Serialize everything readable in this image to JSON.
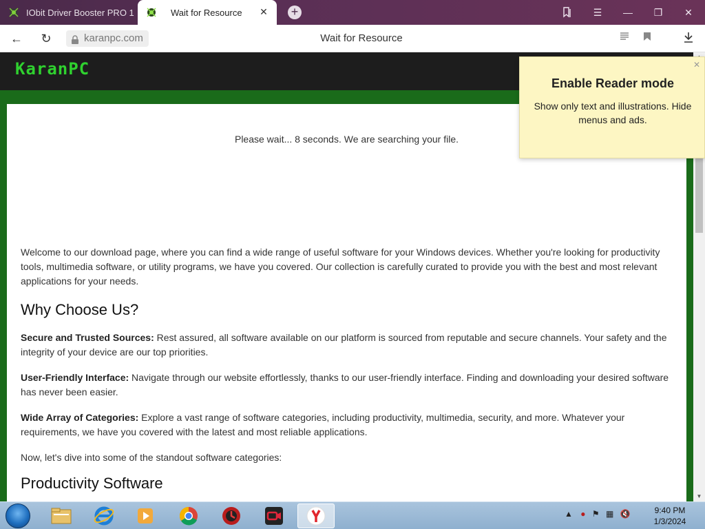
{
  "browser": {
    "tabs": [
      {
        "label": "IObit Driver Booster PRO 1",
        "active": false
      },
      {
        "label": "Wait for Resource",
        "active": true
      }
    ],
    "url": "karanpc.com",
    "page_title": "Wait for Resource",
    "colors": {
      "tabbar": "#5a2f55",
      "logo": "#2fd12f",
      "band": "#1a6b1a"
    }
  },
  "site": {
    "logo": "KaranPC",
    "wait_message": "Please wait... 8 seconds. We are searching your file."
  },
  "article": {
    "intro": "Welcome to our download page, where you can find a wide range of useful software for your Windows devices. Whether you're looking for productivity tools, multimedia software, or utility programs, we have you covered. Our collection is carefully curated to provide you with the best and most relevant applications for your needs.",
    "why_heading": "Why Choose Us?",
    "points": [
      {
        "title": "Secure and Trusted Sources:",
        "text": " Rest assured, all software available on our platform is sourced from reputable and secure channels. Your safety and the integrity of your device are our top priorities."
      },
      {
        "title": "User-Friendly Interface:",
        "text": " Navigate through our website effortlessly, thanks to our user-friendly interface. Finding and downloading your desired software has never been easier."
      },
      {
        "title": "Wide Array of Categories:",
        "text": " Explore a vast range of software categories, including productivity, multimedia, security, and more. Whatever your requirements, we have you covered with the latest and most reliable applications."
      }
    ],
    "dive_text": "Now, let's dive into some of the standout software categories:",
    "next_heading": "Productivity Software"
  },
  "reader_popup": {
    "title": "Enable Reader mode",
    "description": "Show only text and illustrations. Hide menus and ads."
  },
  "taskbar": {
    "time": "9:40 PM",
    "date": "1/3/2024"
  }
}
